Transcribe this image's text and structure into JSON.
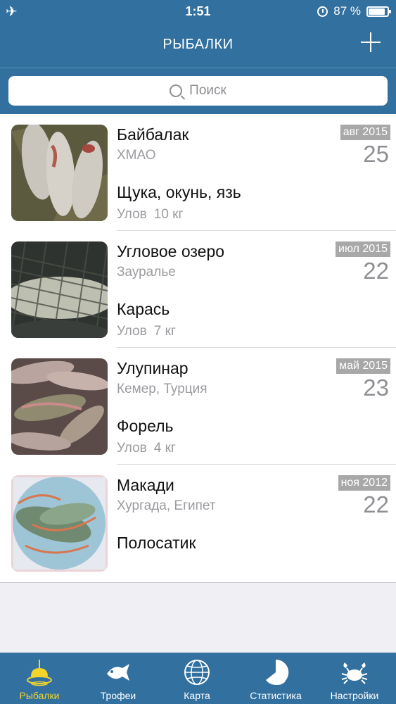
{
  "status_bar": {
    "time": "1:51",
    "battery": "87 %",
    "battery_level": 0.87
  },
  "nav": {
    "title": "РЫБАЛКИ",
    "add_icon": "plus-icon"
  },
  "search": {
    "placeholder": "Поиск"
  },
  "trips": [
    {
      "name": "Байбалак",
      "region": "ХМАО",
      "fish": "Щука, окунь, язь",
      "catch_label": "Улов",
      "catch_value": "10 кг",
      "month": "авг 2015",
      "day": "25",
      "photo": "fish-on-grass-photo"
    },
    {
      "name": "Угловое озеро",
      "region": "Зауралье",
      "fish": "Карась",
      "catch_label": "Улов",
      "catch_value": "7 кг",
      "month": "июл 2015",
      "day": "22",
      "photo": "carp-in-net-photo"
    },
    {
      "name": "Улупинар",
      "region": "Кемер, Турция",
      "fish": "Форель",
      "catch_label": "Улов",
      "catch_value": "4 кг",
      "month": "май 2015",
      "day": "23",
      "photo": "trout-pile-photo"
    },
    {
      "name": "Макади",
      "region": "Хургада, Египет",
      "fish": "Полосатик",
      "catch_label": "",
      "catch_value": "",
      "month": "ноя 2012",
      "day": "22",
      "photo": "fish-in-bag-photo"
    }
  ],
  "tabs": [
    {
      "label": "Рыбалки",
      "icon": "float-bobber-icon",
      "active": true
    },
    {
      "label": "Трофеи",
      "icon": "fish-icon",
      "active": false
    },
    {
      "label": "Карта",
      "icon": "globe-icon",
      "active": false
    },
    {
      "label": "Статистика",
      "icon": "pie-chart-icon",
      "active": false
    },
    {
      "label": "Настройки",
      "icon": "crab-icon",
      "active": false
    }
  ],
  "colors": {
    "bar": "#31709f",
    "active_tab": "#f3d52c",
    "date_badge": "#a8a8a8"
  }
}
